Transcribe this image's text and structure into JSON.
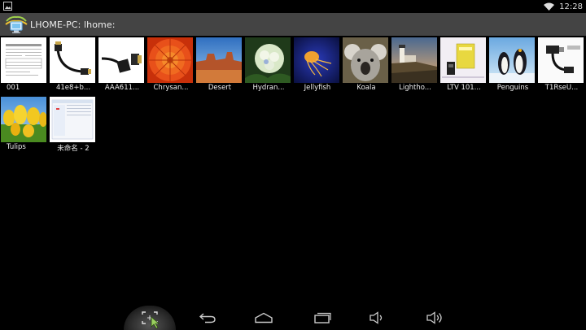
{
  "status_bar": {
    "time": "12:28",
    "left_icon": "gallery-notification-icon",
    "wifi_icon": "wifi-icon"
  },
  "title_bar": {
    "title": "LHOME-PC: lhome:",
    "icon": "network-computer-icon"
  },
  "files": [
    {
      "name": "001",
      "thumb": "document"
    },
    {
      "name": "41e8+b...",
      "thumb": "hdmi-cable"
    },
    {
      "name": "AAA611...",
      "thumb": "hdmi-adapter"
    },
    {
      "name": "Chrysan...",
      "thumb": "flower-orange"
    },
    {
      "name": "Desert",
      "thumb": "desert"
    },
    {
      "name": "Hydran...",
      "thumb": "hydrangea"
    },
    {
      "name": "Jellyfish",
      "thumb": "jellyfish"
    },
    {
      "name": "Koala",
      "thumb": "koala"
    },
    {
      "name": "Lightho...",
      "thumb": "lighthouse"
    },
    {
      "name": "LTV 101...",
      "thumb": "product"
    },
    {
      "name": "Penguins",
      "thumb": "penguins"
    },
    {
      "name": "T1RseU...",
      "thumb": "connector"
    },
    {
      "name": "Tulips",
      "thumb": "tulips"
    },
    {
      "name": "未命名 - 2",
      "thumb": "screenshot"
    }
  ],
  "nav_bar": {
    "buttons": [
      "screenshot-button",
      "back-button",
      "home-button",
      "recent-apps-button",
      "volume-down-button",
      "volume-up-button"
    ]
  }
}
